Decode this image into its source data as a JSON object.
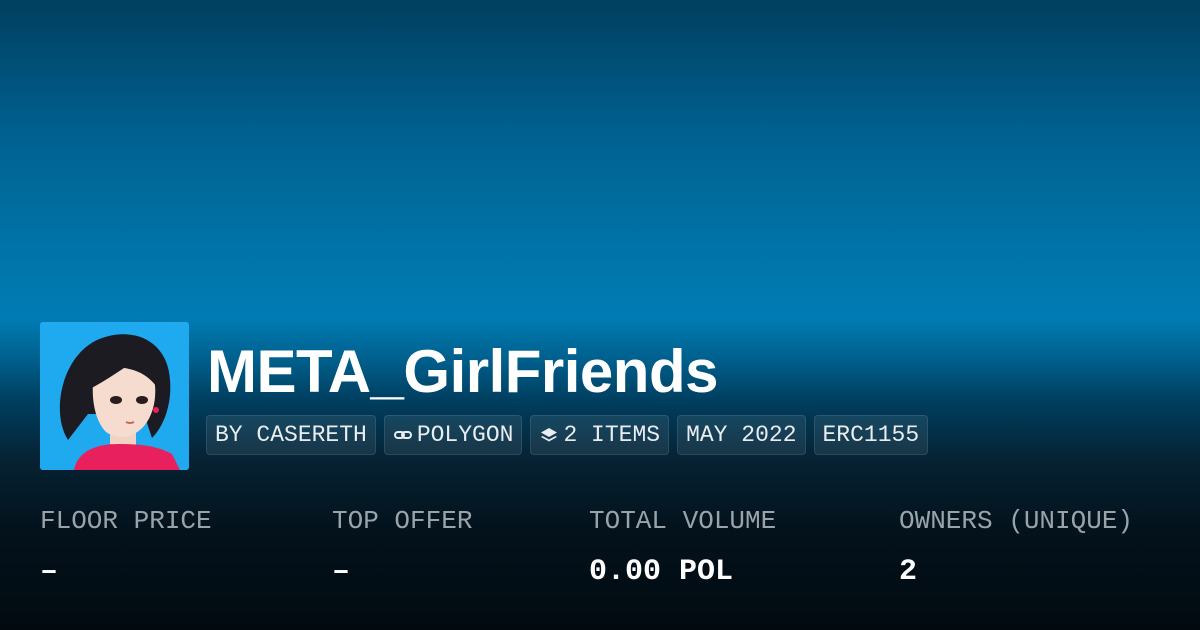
{
  "collection": {
    "name": "META_GirlFriends",
    "avatar_icon": "collection-avatar-girl-portrait",
    "avatar_bg": "#1fa9ee"
  },
  "badges": {
    "creator": "BY CASERETH",
    "chain": "POLYGON",
    "chain_icon": "link-icon",
    "items": "2 ITEMS",
    "items_icon": "layers-icon",
    "date": "MAY 2022",
    "standard": "ERC1155"
  },
  "stats": [
    {
      "label": "FLOOR PRICE",
      "value": "–"
    },
    {
      "label": "TOP OFFER",
      "value": "–"
    },
    {
      "label": "TOTAL VOLUME",
      "value": "0.00 POL"
    },
    {
      "label": "OWNERS (UNIQUE)",
      "value": "2"
    }
  ],
  "colors": {
    "background_top": "#003f5f",
    "background_mid": "#007cb4",
    "background_bottom": "#020a10",
    "label": "#9aa3aa",
    "value": "#ffffff"
  }
}
